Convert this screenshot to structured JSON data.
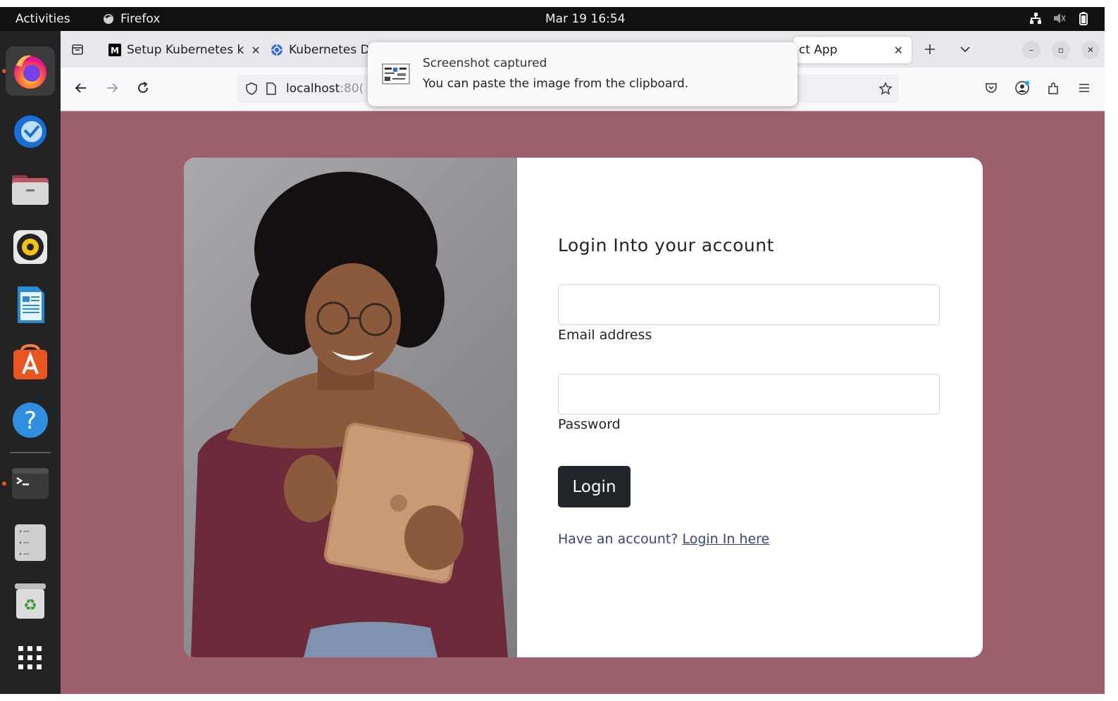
{
  "topbar": {
    "activities": "Activities",
    "app_name": "Firefox",
    "clock": "Mar 19  16:54"
  },
  "tabs": [
    {
      "title": "Setup Kubernetes k",
      "favicon": "medium-icon"
    },
    {
      "title": "Kubernetes D",
      "favicon": "kubernetes-icon"
    },
    {
      "title": "ct App",
      "favicon": ""
    }
  ],
  "address": {
    "host": "localhost",
    "port_fragment": ":80("
  },
  "notification": {
    "title": "Screenshot captured",
    "body": "You can paste the image from the clipboard."
  },
  "login_form": {
    "title": "Login Into your account",
    "email_label": "Email address",
    "email_value": "",
    "password_label": "Password",
    "password_value": "",
    "button_label": "Login",
    "signup_text": "Have an account?",
    "signup_link": "Login In here"
  },
  "colors": {
    "page_background": "#9c616d",
    "button": "#212529",
    "link": "#393f81",
    "ubuntu_orange": "#e95420"
  }
}
